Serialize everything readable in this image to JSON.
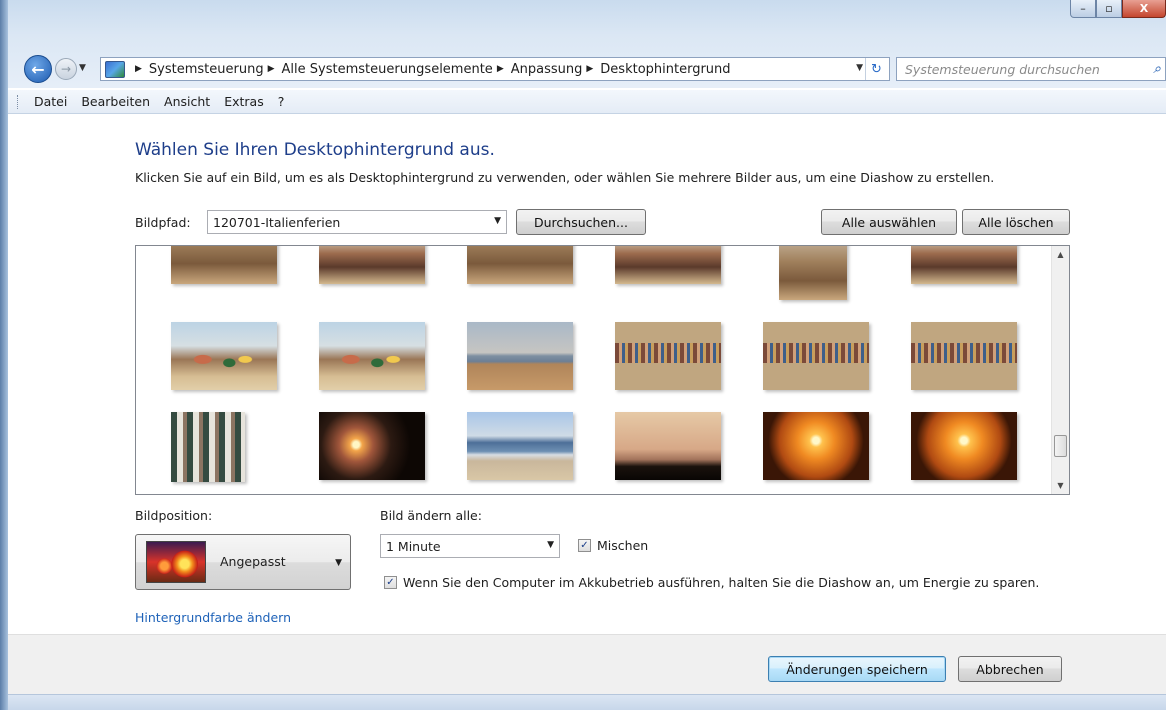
{
  "window": {
    "caption_min": "–",
    "caption_max": "▫",
    "caption_close": "X"
  },
  "nav": {
    "back": "←",
    "forward": "→",
    "dropdown": "▼",
    "breadcrumbs": [
      "Systemsteuerung",
      "Alle Systemsteuerungselemente",
      "Anpassung",
      "Desktophintergrund"
    ],
    "separator": "▶",
    "refresh": "↻",
    "search_placeholder": "Systemsteuerung durchsuchen",
    "search_icon": "⌕"
  },
  "menu": [
    "Datei",
    "Bearbeiten",
    "Ansicht",
    "Extras",
    "?"
  ],
  "main": {
    "heading": "Wählen Sie Ihren Desktophintergrund aus.",
    "description": "Klicken Sie auf ein Bild, um es als Desktophintergrund zu verwenden, oder wählen Sie mehrere Bilder aus, um eine Diashow zu erstellen.",
    "path_label": "Bildpfad:",
    "path_value": "120701-Italienferien",
    "browse_button": "Durchsuchen...",
    "select_all_button": "Alle auswählen",
    "clear_all_button": "Alle löschen",
    "combo_arrow": "▼"
  },
  "gallery": {
    "scroll_up": "▲",
    "scroll_down": "▼",
    "scroll_position": 0.82
  },
  "options": {
    "position_label": "Bildposition:",
    "position_value": "Angepasst",
    "interval_label": "Bild ändern alle:",
    "interval_value": "1 Minute",
    "shuffle_label": "Mischen",
    "shuffle_checked": true,
    "battery_label": "Wenn Sie den Computer im Akkubetrieb ausführen, halten Sie die Diashow an, um Energie zu sparen.",
    "battery_checked": true,
    "check_mark": "✓",
    "bg_color_link": "Hintergrundfarbe ändern"
  },
  "footer": {
    "save_button": "Änderungen speichern",
    "cancel_button": "Abbrechen"
  }
}
